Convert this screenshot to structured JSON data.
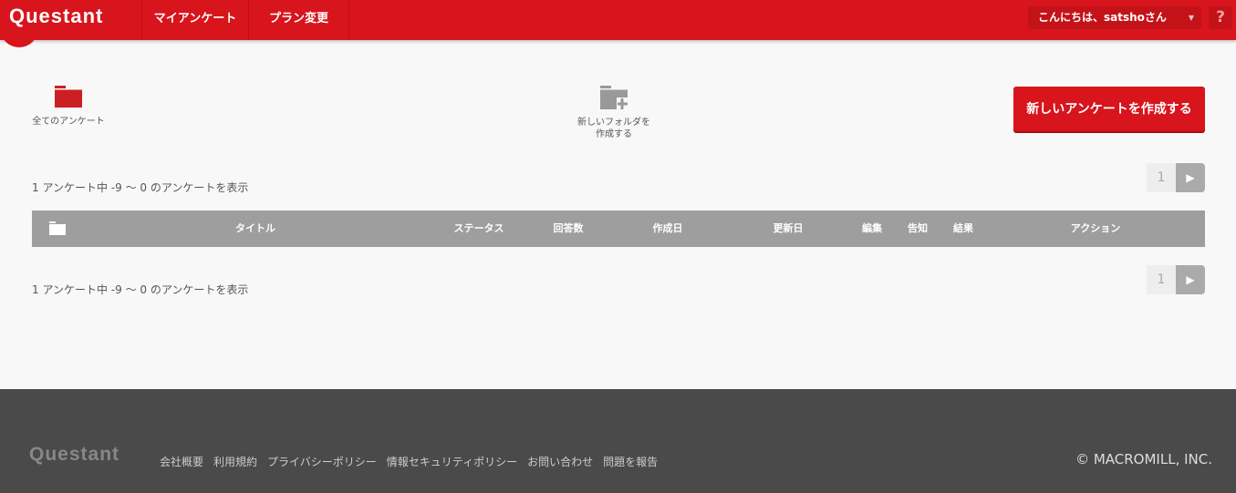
{
  "header": {
    "logo": "Questant",
    "nav": [
      "マイアンケート",
      "プラン変更"
    ],
    "greeting": "こんにちは、satshoさん",
    "help": "?"
  },
  "toolbar": {
    "all_surveys": "全てのアンケート",
    "new_folder_line1": "新しいフォルダを",
    "new_folder_line2": "作成する",
    "create_button": "新しいアンケートを作成する"
  },
  "list": {
    "count_text": "1 アンケート中 -9 ～ 0 のアンケートを表示",
    "page": "1",
    "columns": [
      "タイトル",
      "ステータス",
      "回答数",
      "作成日",
      "更新日",
      "編集",
      "告知",
      "結果",
      "アクション"
    ]
  },
  "footer": {
    "logo": "Questant",
    "links": [
      "会社概要",
      "利用規約",
      "プライバシーポリシー",
      "情報セキュリティポリシー",
      "お問い合わせ",
      "問題を報告"
    ],
    "copyright": "© MACROMILL, INC."
  },
  "colors": {
    "brand": "#d8141c",
    "footer": "#4a4a4a",
    "table_header": "#9e9e9e"
  }
}
